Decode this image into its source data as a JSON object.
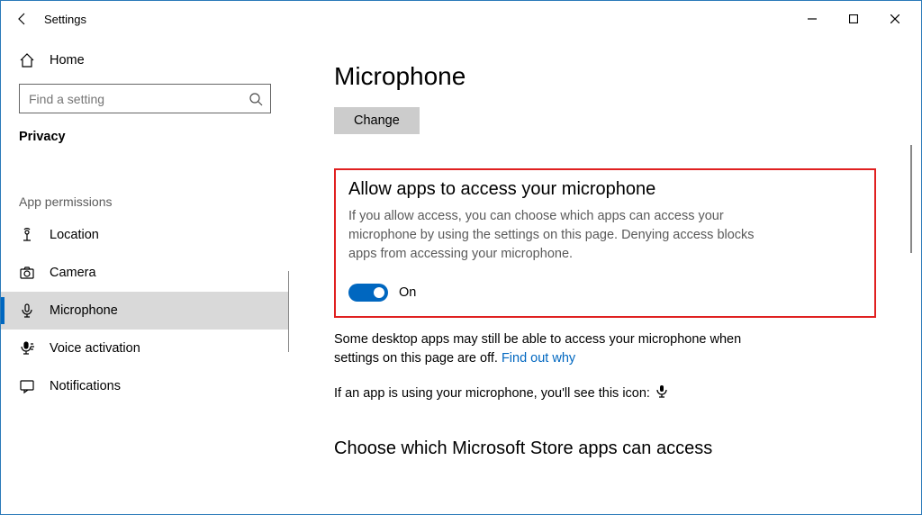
{
  "window": {
    "title": "Settings"
  },
  "sidebar": {
    "home": "Home",
    "search_placeholder": "Find a setting",
    "section": "Privacy",
    "group_label": "App permissions",
    "items": [
      {
        "label": "Location"
      },
      {
        "label": "Camera"
      },
      {
        "label": "Microphone"
      },
      {
        "label": "Voice activation"
      },
      {
        "label": "Notifications"
      }
    ]
  },
  "main": {
    "title": "Microphone",
    "change_button": "Change",
    "allow_heading": "Allow apps to access your microphone",
    "allow_desc": "If you allow access, you can choose which apps can access your microphone by using the settings on this page. Denying access blocks apps from accessing your microphone.",
    "toggle_state": "On",
    "desktop_note_pre": "Some desktop apps may still be able to access your microphone when settings on this page are off. ",
    "desktop_note_link": "Find out why",
    "icon_note": "If an app is using your microphone, you'll see this icon:",
    "choose_heading": "Choose which Microsoft Store apps can access"
  }
}
